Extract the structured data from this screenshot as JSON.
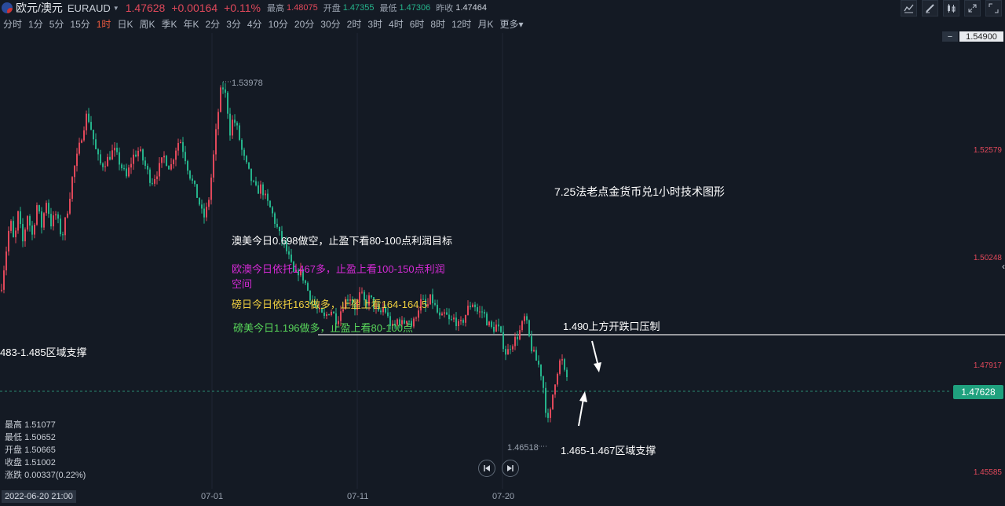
{
  "header": {
    "symbol_name": "欧元/澳元",
    "symbol_code": "EURAUD",
    "last_price": "1.47628",
    "change": "+0.00164",
    "change_pct": "+0.11%",
    "high_label": "最高",
    "high": "1.48075",
    "open_label": "开盘",
    "open": "1.47355",
    "low_label": "最低",
    "low": "1.47306",
    "prev_label": "昨收",
    "prev_close": "1.47464"
  },
  "periods": [
    "分时",
    "1分",
    "5分",
    "15分",
    "1时",
    "日K",
    "周K",
    "季K",
    "年K",
    "2分",
    "3分",
    "4分",
    "10分",
    "20分",
    "30分",
    "2时",
    "3时",
    "4时",
    "6时",
    "8时",
    "12时",
    "月K",
    "更多"
  ],
  "active_period": "1时",
  "yaxis": {
    "top_badge_icon": "−",
    "top_badge": "1.54900",
    "labels": [
      {
        "v": "1.52579",
        "y": 1.52579
      },
      {
        "v": "1.50248",
        "y": 1.50248
      },
      {
        "v": "1.47917",
        "y": 1.47917
      },
      {
        "v": "1.45585",
        "y": 1.45585
      }
    ],
    "last_badge": "1.47628"
  },
  "annotations": {
    "title": "7.25法老点金货币兑1小时技术图形",
    "resistance": "1.490上方开跌口压制",
    "support_low": "1.465-1.467区域支撑",
    "support_left": "483-1.485区域支撑",
    "aud_usd": "澳美今日0.698做空，止盈下看80-100点利润目标",
    "eur_aud": "欧澳今日依托1467多，止盈上看100-150点利润空间",
    "gbp_jpy": "磅日今日依托163做多，止盈上看164-164.5",
    "gbp_usd": "磅美今日1.196做多，止盈上看80-100点"
  },
  "peak_label": "1.53978",
  "trough_label": "1.46518",
  "stats": {
    "high_label": "最高",
    "high": "1.51077",
    "low_label": "最低",
    "low": "1.50652",
    "open_label": "开盘",
    "open": "1.50665",
    "close_label": "收盘",
    "close": "1.51002",
    "chg_label": "涨跌",
    "chg": "0.00337(0.22%)"
  },
  "time_axis": {
    "start": "2022-06-20 21:00",
    "ticks": [
      "07-01",
      "07-11",
      "07-20"
    ]
  },
  "colors": {
    "up": "#e0485a",
    "down": "#25b28a",
    "bg": "#141a24",
    "active": "#ee5a3f"
  },
  "chart_data": {
    "type": "candlestick",
    "interval": "1时",
    "ylim": [
      1.4525,
      1.55
    ],
    "horizontal_line": 1.4935,
    "last_price": 1.47628,
    "peak": 1.53978,
    "trough": 1.46518,
    "close_path": [
      [
        0,
        1.4955
      ],
      [
        6,
        1.503
      ],
      [
        12,
        1.511
      ],
      [
        17,
        1.5055
      ],
      [
        22,
        1.512
      ],
      [
        28,
        1.506
      ],
      [
        34,
        1.512
      ],
      [
        40,
        1.5075
      ],
      [
        46,
        1.514
      ],
      [
        52,
        1.5095
      ],
      [
        58,
        1.515
      ],
      [
        64,
        1.51
      ],
      [
        70,
        1.512
      ],
      [
        78,
        1.507
      ],
      [
        86,
        1.514
      ],
      [
        92,
        1.521
      ],
      [
        98,
        1.525
      ],
      [
        104,
        1.53
      ],
      [
        110,
        1.534
      ],
      [
        116,
        1.53
      ],
      [
        122,
        1.525
      ],
      [
        128,
        1.5225
      ],
      [
        136,
        1.524
      ],
      [
        144,
        1.526
      ],
      [
        152,
        1.523
      ],
      [
        160,
        1.52
      ],
      [
        168,
        1.5245
      ],
      [
        176,
        1.526
      ],
      [
        184,
        1.5225
      ],
      [
        192,
        1.519
      ],
      [
        200,
        1.5215
      ],
      [
        208,
        1.5245
      ],
      [
        216,
        1.522
      ],
      [
        222,
        1.526
      ],
      [
        228,
        1.5285
      ],
      [
        234,
        1.525
      ],
      [
        240,
        1.521
      ],
      [
        246,
        1.518
      ],
      [
        252,
        1.515
      ],
      [
        258,
        1.511
      ],
      [
        264,
        1.514
      ],
      [
        270,
        1.523
      ],
      [
        276,
        1.533
      ],
      [
        280,
        1.5385
      ],
      [
        284,
        1.5398
      ],
      [
        288,
        1.536
      ],
      [
        292,
        1.53
      ],
      [
        296,
        1.533
      ],
      [
        302,
        1.53
      ],
      [
        308,
        1.525
      ],
      [
        314,
        1.522
      ],
      [
        320,
        1.519
      ],
      [
        326,
        1.517
      ],
      [
        332,
        1.518
      ],
      [
        338,
        1.515
      ],
      [
        344,
        1.513
      ],
      [
        350,
        1.51
      ],
      [
        356,
        1.507
      ],
      [
        362,
        1.505
      ],
      [
        368,
        1.502
      ],
      [
        374,
        1.4985
      ],
      [
        380,
        1.5
      ],
      [
        386,
        1.498
      ],
      [
        392,
        1.495
      ],
      [
        398,
        1.493
      ],
      [
        404,
        1.491
      ],
      [
        412,
        1.4895
      ],
      [
        420,
        1.4915
      ],
      [
        428,
        1.489
      ],
      [
        436,
        1.4925
      ],
      [
        444,
        1.4945
      ],
      [
        452,
        1.4915
      ],
      [
        458,
        1.495
      ],
      [
        464,
        1.4925
      ],
      [
        470,
        1.494
      ],
      [
        476,
        1.492
      ],
      [
        482,
        1.49
      ],
      [
        488,
        1.492
      ],
      [
        494,
        1.489
      ],
      [
        500,
        1.487
      ],
      [
        506,
        1.4895
      ],
      [
        512,
        1.488
      ],
      [
        518,
        1.49
      ],
      [
        524,
        1.4875
      ],
      [
        530,
        1.491
      ],
      [
        536,
        1.4935
      ],
      [
        542,
        1.4915
      ],
      [
        548,
        1.494
      ],
      [
        554,
        1.4915
      ],
      [
        560,
        1.489
      ],
      [
        566,
        1.4905
      ],
      [
        572,
        1.4885
      ],
      [
        578,
        1.4895
      ],
      [
        584,
        1.4875
      ],
      [
        590,
        1.4895
      ],
      [
        596,
        1.492
      ],
      [
        602,
        1.493
      ],
      [
        608,
        1.4905
      ],
      [
        614,
        1.491
      ],
      [
        620,
        1.4885
      ],
      [
        626,
        1.487
      ],
      [
        632,
        1.488
      ],
      [
        638,
        1.485
      ],
      [
        644,
        1.4815
      ],
      [
        650,
        1.484
      ],
      [
        656,
        1.485
      ],
      [
        662,
        1.487
      ],
      [
        668,
        1.49
      ],
      [
        672,
        1.486
      ],
      [
        676,
        1.483
      ],
      [
        680,
        1.481
      ],
      [
        686,
        1.479
      ],
      [
        690,
        1.476
      ],
      [
        694,
        1.47
      ],
      [
        698,
        1.466
      ],
      [
        702,
        1.472
      ],
      [
        706,
        1.476
      ],
      [
        710,
        1.479
      ],
      [
        714,
        1.481
      ],
      [
        718,
        1.4775
      ],
      [
        722,
        1.4763
      ]
    ]
  }
}
